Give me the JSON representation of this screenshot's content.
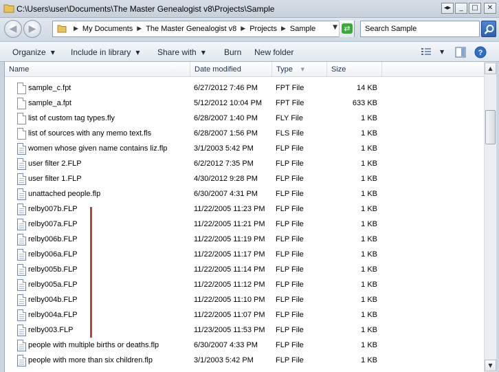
{
  "window": {
    "title": "C:\\Users\\user\\Documents\\The Master Genealogist v8\\Projects\\Sample",
    "buttons": [
      "restore-icon",
      "minimize-icon",
      "maximize-icon",
      "close-icon"
    ]
  },
  "address": {
    "breadcrumbs": [
      "My Documents",
      "The Master Genealogist v8",
      "Projects",
      "Sample"
    ]
  },
  "search": {
    "placeholder": "Search Sample"
  },
  "toolbar": {
    "organize": "Organize",
    "include_in_library": "Include in library",
    "share_with": "Share with",
    "burn": "Burn",
    "new_folder": "New folder"
  },
  "columns": {
    "name": "Name",
    "date_modified": "Date modified",
    "type": "Type",
    "size": "Size"
  },
  "files": [
    {
      "name": "sample_c.fpt",
      "date": "6/27/2012 7:46 PM",
      "type": "FPT File",
      "size": "14 KB",
      "icon": "document-icon"
    },
    {
      "name": "sample_a.fpt",
      "date": "5/12/2012 10:04 PM",
      "type": "FPT File",
      "size": "633 KB",
      "icon": "document-icon"
    },
    {
      "name": "list of custom tag types.fly",
      "date": "6/28/2007 1:40 PM",
      "type": "FLY File",
      "size": "1 KB",
      "icon": "document-icon"
    },
    {
      "name": "list of sources with any memo text.fls",
      "date": "6/28/2007 1:56 PM",
      "type": "FLS File",
      "size": "1 KB",
      "icon": "document-icon"
    },
    {
      "name": "women whose given name contains liz.flp",
      "date": "3/1/2003 5:42 PM",
      "type": "FLP File",
      "size": "1 KB",
      "icon": "flp-document-icon"
    },
    {
      "name": "user filter 2.FLP",
      "date": "6/2/2012 7:35 PM",
      "type": "FLP File",
      "size": "1 KB",
      "icon": "flp-document-icon"
    },
    {
      "name": "user filter 1.FLP",
      "date": "4/30/2012 9:28 PM",
      "type": "FLP File",
      "size": "1 KB",
      "icon": "flp-document-icon"
    },
    {
      "name": "unattached people.flp",
      "date": "6/30/2007 4:31 PM",
      "type": "FLP File",
      "size": "1 KB",
      "icon": "flp-document-icon"
    },
    {
      "name": "relby007b.FLP",
      "date": "11/22/2005 11:23 PM",
      "type": "FLP File",
      "size": "1 KB",
      "icon": "flp-document-icon"
    },
    {
      "name": "relby007a.FLP",
      "date": "11/22/2005 11:21 PM",
      "type": "FLP File",
      "size": "1 KB",
      "icon": "flp-document-icon"
    },
    {
      "name": "relby006b.FLP",
      "date": "11/22/2005 11:19 PM",
      "type": "FLP File",
      "size": "1 KB",
      "icon": "flp-document-icon"
    },
    {
      "name": "relby006a.FLP",
      "date": "11/22/2005 11:17 PM",
      "type": "FLP File",
      "size": "1 KB",
      "icon": "flp-document-icon"
    },
    {
      "name": "relby005b.FLP",
      "date": "11/22/2005 11:14 PM",
      "type": "FLP File",
      "size": "1 KB",
      "icon": "flp-document-icon"
    },
    {
      "name": "relby005a.FLP",
      "date": "11/22/2005 11:12 PM",
      "type": "FLP File",
      "size": "1 KB",
      "icon": "flp-document-icon"
    },
    {
      "name": "relby004b.FLP",
      "date": "11/22/2005 11:10 PM",
      "type": "FLP File",
      "size": "1 KB",
      "icon": "flp-document-icon"
    },
    {
      "name": "relby004a.FLP",
      "date": "11/22/2005 11:07 PM",
      "type": "FLP File",
      "size": "1 KB",
      "icon": "flp-document-icon"
    },
    {
      "name": "relby003.FLP",
      "date": "11/23/2005 11:53 PM",
      "type": "FLP File",
      "size": "1 KB",
      "icon": "flp-document-icon"
    },
    {
      "name": "people with multiple births or deaths.flp",
      "date": "6/30/2007 4:33 PM",
      "type": "FLP File",
      "size": "1 KB",
      "icon": "flp-document-icon"
    },
    {
      "name": "people with more than six children.flp",
      "date": "3/1/2003 5:42 PM",
      "type": "FLP File",
      "size": "1 KB",
      "icon": "flp-document-icon"
    }
  ],
  "colors": {
    "marker": "#b0473c",
    "refresh": "#3aa83a",
    "search_button": "#2a5fae"
  }
}
